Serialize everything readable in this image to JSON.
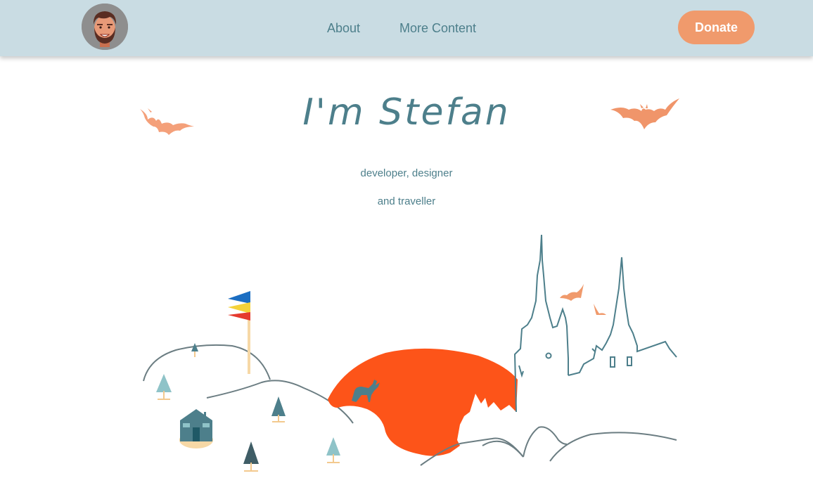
{
  "nav": {
    "links": [
      {
        "label": "About"
      },
      {
        "label": "More Content"
      }
    ],
    "donate_label": "Donate"
  },
  "hero": {
    "title": "I'm Stefan",
    "subtitle_line1": "developer, designer",
    "subtitle_line2": "and traveller"
  },
  "colors": {
    "header_bg": "#c9dce3",
    "accent": "#f09a6c",
    "text": "#4d7f8b",
    "hill_orange": "#fd5419",
    "line": "#6b7d82"
  },
  "icons": [
    "avatar",
    "bat-icon",
    "flag-icon",
    "tree-icon",
    "house-icon",
    "deer-icon",
    "castle-icon"
  ]
}
